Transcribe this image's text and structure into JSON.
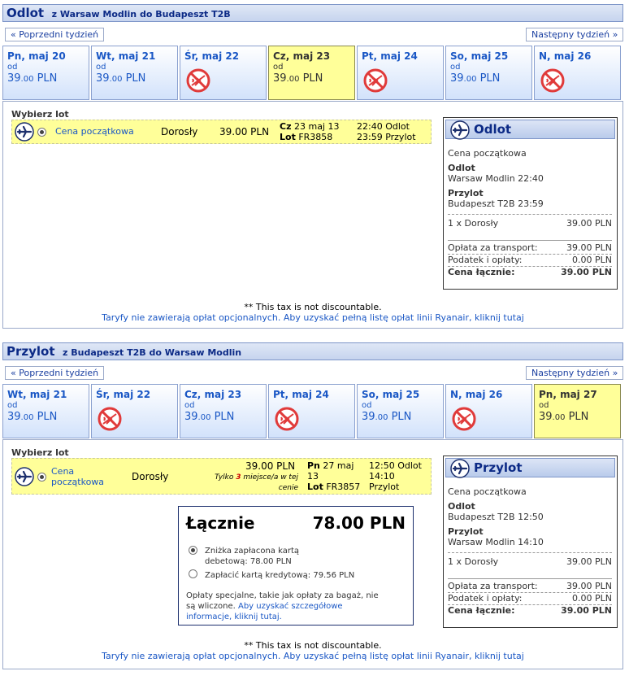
{
  "outbound": {
    "title": "Odlot",
    "route": "z Warsaw Modlin do Budapeszt T2B",
    "prev_week": "« Poprzedni tydzień",
    "next_week": "Następny tydzień »",
    "days": [
      {
        "name": "Pn, maj 20",
        "od": "od",
        "price_int": "39",
        "price_dec": ".00",
        "currency": " PLN",
        "available": true,
        "selected": false
      },
      {
        "name": "Wt, maj 21",
        "od": "od",
        "price_int": "39",
        "price_dec": ".00",
        "currency": " PLN",
        "available": true,
        "selected": false
      },
      {
        "name": "Śr, maj 22",
        "available": false,
        "selected": false
      },
      {
        "name": "Cz, maj 23",
        "od": "od",
        "price_int": "39",
        "price_dec": ".00",
        "currency": " PLN",
        "available": true,
        "selected": true
      },
      {
        "name": "Pt, maj 24",
        "available": false,
        "selected": false
      },
      {
        "name": "So, maj 25",
        "od": "od",
        "price_int": "39",
        "price_dec": ".00",
        "currency": " PLN",
        "available": true,
        "selected": false
      },
      {
        "name": "N, maj 26",
        "available": false,
        "selected": false
      }
    ],
    "choose_label": "Wybierz lot",
    "fare_name": "Cena początkowa",
    "passenger": "Dorosły",
    "price": "39.00 PLN",
    "date_day": "Cz",
    "date_rest": "23 maj 13",
    "flight_label": "Lot",
    "flight_no": "FR3858",
    "dep_time": "22:40 Odlot",
    "arr_time": "23:59 Przylot",
    "summary": {
      "title": "Odlot",
      "fare": "Cena początkowa",
      "dep_label": "Odlot",
      "dep_value": "Warsaw Modlin 22:40",
      "arr_label": "Przylot",
      "arr_value": "Budapeszt T2B 23:59",
      "pax_label": "1 x Dorosły",
      "pax_value": "39.00 PLN",
      "transport_label": "Opłata za transport:",
      "transport_value": "39.00 PLN",
      "tax_label": "Podatek i opłaty:",
      "tax_value": "0.00 PLN",
      "total_label": "Cena łącznie:",
      "total_value": "39.00 PLN"
    },
    "tax_note": "** This tax is not discountable.",
    "fees_note": "Taryfy nie zawierają opłat opcjonalnych. Aby uzyskać pełną listę opłat linii Ryanair, kliknij tutaj"
  },
  "inbound": {
    "title": "Przylot",
    "route": "z Budapeszt T2B do Warsaw Modlin",
    "prev_week": "« Poprzedni tydzień",
    "next_week": "Następny tydzień »",
    "days": [
      {
        "name": "Wt, maj 21",
        "od": "od",
        "price_int": "39",
        "price_dec": ".00",
        "currency": " PLN",
        "available": true,
        "selected": false
      },
      {
        "name": "Śr, maj 22",
        "available": false,
        "selected": false
      },
      {
        "name": "Cz, maj 23",
        "od": "od",
        "price_int": "39",
        "price_dec": ".00",
        "currency": " PLN",
        "available": true,
        "selected": false
      },
      {
        "name": "Pt, maj 24",
        "available": false,
        "selected": false
      },
      {
        "name": "So, maj 25",
        "od": "od",
        "price_int": "39",
        "price_dec": ".00",
        "currency": " PLN",
        "available": true,
        "selected": false
      },
      {
        "name": "N, maj 26",
        "available": false,
        "selected": false
      },
      {
        "name": "Pn, maj 27",
        "od": "od",
        "price_int": "39",
        "price_dec": ".00",
        "currency": " PLN",
        "available": true,
        "selected": true
      }
    ],
    "choose_label": "Wybierz lot",
    "fare_name_1": "Cena",
    "fare_name_2": "początkowa",
    "passenger": "Dorosły",
    "price": "39.00 PLN",
    "seats_pre": "Tylko ",
    "seats_num": "3",
    "seats_post": " miejsce/a w tej",
    "seats_line2": "cenie",
    "date_day": "Pn",
    "date_rest": "27 maj",
    "date_year": "13",
    "flight_label": "Lot",
    "flight_no": "FR3857",
    "dep_time": "12:50 Odlot",
    "arr_time_1": "14:10",
    "arr_time_2": "Przylot",
    "summary": {
      "title": "Przylot",
      "fare": "Cena początkowa",
      "dep_label": "Odlot",
      "dep_value": "Budapeszt T2B 12:50",
      "arr_label": "Przylot",
      "arr_value": "Warsaw Modlin 14:10",
      "pax_label": "1 x Dorosły",
      "pax_value": "39.00 PLN",
      "transport_label": "Opłata za transport:",
      "transport_value": "39.00 PLN",
      "tax_label": "Podatek i opłaty:",
      "tax_value": "0.00 PLN",
      "total_label": "Cena łącznie:",
      "total_value": "39.00 PLN"
    },
    "tax_note": "** This tax is not discountable.",
    "fees_note": "Taryfy nie zawierają opłat opcjonalnych. Aby uzyskać pełną listę opłat linii Ryanair, kliknij tutaj"
  },
  "total": {
    "label": "Łącznie",
    "value": "78.00 PLN",
    "debit_line1": "Zniżka zapłacona kartą",
    "debit_line2": "debetową: 78.00 PLN",
    "credit_label": "Zapłacić kartą kredytową: 79.56 PLN",
    "extra_1": "Opłaty specjalne, takie jak opłaty za bagaż, nie",
    "extra_2a": "są wliczone.",
    "extra_2b": "Aby uzyskać szczegółowe",
    "extra_3": "informacje, kliknij tutaj."
  },
  "colors": {
    "accent": "#0c2a86",
    "link": "#1a57c5",
    "selected_day": "#ffff99",
    "no_flight": "#e03a3a"
  }
}
